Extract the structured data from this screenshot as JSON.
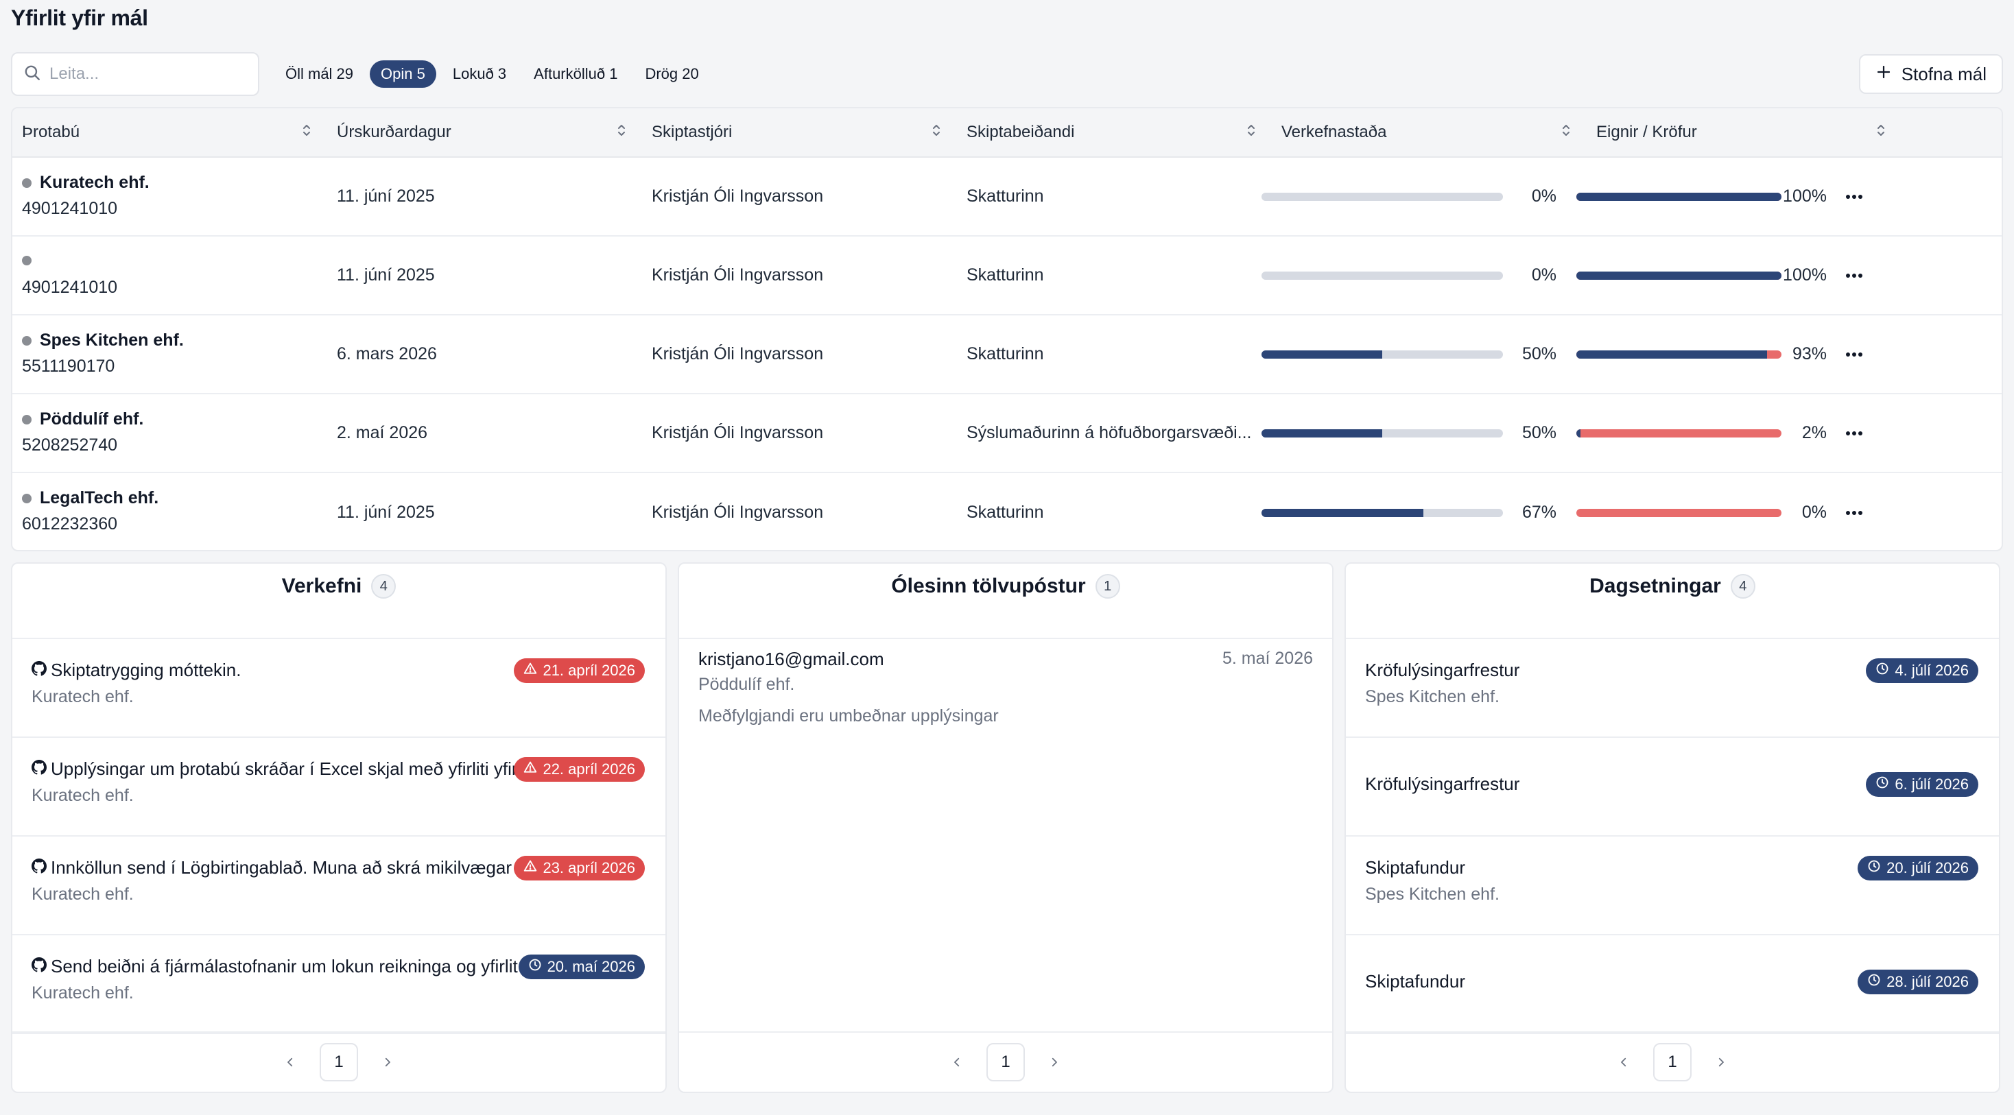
{
  "page": {
    "title": "Yfirlit yfir mál"
  },
  "search": {
    "placeholder": "Leita..."
  },
  "filters": [
    {
      "label": "Öll mál 29",
      "active": false
    },
    {
      "label": "Opin 5",
      "active": true
    },
    {
      "label": "Lokuð 3",
      "active": false
    },
    {
      "label": "Afturkölluð 1",
      "active": false
    },
    {
      "label": "Drög 20",
      "active": false
    }
  ],
  "create_button": {
    "label": "Stofna mál"
  },
  "table": {
    "headers": [
      "Þrotabú",
      "Úrskurðardagur",
      "Skiptastjóri",
      "Skiptabeiðandi",
      "Verkefnastaða",
      "Eignir / Kröfur"
    ],
    "rows": [
      {
        "name": "Kuratech ehf.",
        "id": "4901241010",
        "date": "11. júní 2025",
        "manager": "Kristján Óli Ingvarsson",
        "petitioner": "Skatturinn",
        "tasks_pct": 0,
        "tasks_label": "0%",
        "assets_pct": 100,
        "assets_label": "100%"
      },
      {
        "name": "",
        "id": "4901241010",
        "date": "11. júní 2025",
        "manager": "Kristján Óli Ingvarsson",
        "petitioner": "Skatturinn",
        "tasks_pct": 0,
        "tasks_label": "0%",
        "assets_pct": 100,
        "assets_label": "100%"
      },
      {
        "name": "Spes Kitchen ehf.",
        "id": "5511190170",
        "date": "6. mars 2026",
        "manager": "Kristján Óli Ingvarsson",
        "petitioner": "Skatturinn",
        "tasks_pct": 50,
        "tasks_label": "50%",
        "assets_pct": 93,
        "assets_label": "93%"
      },
      {
        "name": "Pöddulíf ehf.",
        "id": "5208252740",
        "date": "2. maí 2026",
        "manager": "Kristján Óli Ingvarsson",
        "petitioner": "Sýslumaðurinn á höfuðborgarsvæði...",
        "tasks_pct": 50,
        "tasks_label": "50%",
        "assets_pct": 2,
        "assets_label": "2%"
      },
      {
        "name": "LegalTech ehf.",
        "id": "6012232360",
        "date": "11. júní 2025",
        "manager": "Kristján Óli Ingvarsson",
        "petitioner": "Skatturinn",
        "tasks_pct": 67,
        "tasks_label": "67%",
        "assets_pct": 0,
        "assets_label": "0%"
      }
    ]
  },
  "tasks_panel": {
    "title": "Verkefni",
    "count": "4",
    "items": [
      {
        "title": "Skiptatrygging móttekin.",
        "estate": "Kuratech ehf.",
        "date": "21. apríl 2026",
        "status": "overdue"
      },
      {
        "title": "Upplýsingar um þrotabú skráðar í Excel skjal með yfirliti yfir",
        "estate": "Kuratech ehf.",
        "date": "22. apríl 2026",
        "status": "overdue"
      },
      {
        "title": "Innköllun send í Lögbirtingablað. Muna að skrá mikilvægar",
        "estate": "Kuratech ehf.",
        "date": "23. apríl 2026",
        "status": "overdue"
      },
      {
        "title": "Send beiðni á fjármálastofnanir um lokun reikninga og yfirlit",
        "estate": "Kuratech ehf.",
        "date": "20. maí 2026",
        "status": "upcoming"
      }
    ],
    "page": "1"
  },
  "email_panel": {
    "title": "Ólesinn tölvupóstur",
    "count": "1",
    "items": [
      {
        "from": "kristjano16@gmail.com",
        "date": "5. maí 2026",
        "estate": "Pöddulíf ehf.",
        "body": "Meðfylgjandi eru umbeðnar upplýsingar"
      }
    ],
    "page": "1"
  },
  "dates_panel": {
    "title": "Dagsetningar",
    "count": "4",
    "items": [
      {
        "title": "Kröfulýsingarfrestur",
        "estate": "Spes Kitchen ehf.",
        "date": "4. júlí 2026"
      },
      {
        "title": "Kröfulýsingarfrestur",
        "estate": "",
        "date": "6. júlí 2026"
      },
      {
        "title": "Skiptafundur",
        "estate": "Spes Kitchen ehf.",
        "date": "20. júlí 2026"
      },
      {
        "title": "Skiptafundur",
        "estate": "",
        "date": "28. júlí 2026"
      }
    ],
    "page": "1"
  },
  "colors": {
    "accent": "#2c4577",
    "overdue": "#de4b4b",
    "claims_bar": "#e86b6b",
    "track": "#d6dae2",
    "background": "#f4f5f7"
  },
  "icons": {
    "search": "search-icon",
    "plus": "plus-icon",
    "sort": "sort-icon",
    "more": "more-horizontal-icon",
    "task": "github-icon",
    "warning": "warning-triangle-icon",
    "clock": "clock-icon",
    "prev": "chevron-left-icon",
    "next": "chevron-right-icon"
  }
}
